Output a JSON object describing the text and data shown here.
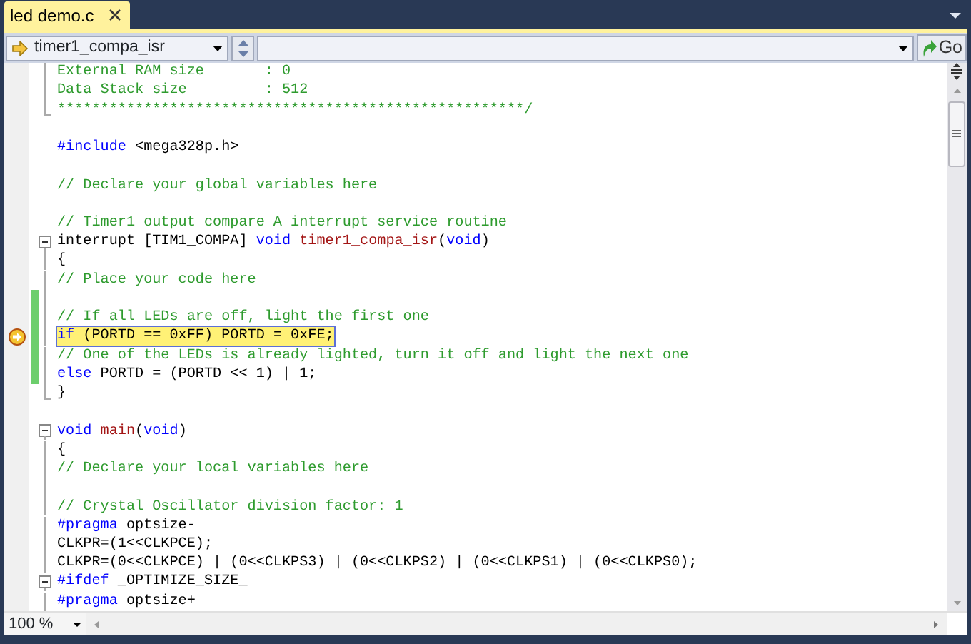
{
  "tab": {
    "title": "led demo.c",
    "selected": true
  },
  "toolbar": {
    "member_dropdown": {
      "value": "timer1_compa_isr"
    },
    "go_button": {
      "label": "Go"
    }
  },
  "code_lines": [
    {
      "segments": [
        {
          "kind": "comment",
          "text": "External RAM size       : 0"
        }
      ],
      "collapsible": false,
      "in_region": true,
      "region_end": false,
      "changed": false,
      "current": false
    },
    {
      "segments": [
        {
          "kind": "comment",
          "text": "Data Stack size         : 512"
        }
      ],
      "collapsible": false,
      "in_region": true,
      "region_end": false,
      "changed": false,
      "current": false
    },
    {
      "segments": [
        {
          "kind": "comment",
          "text": "******************************************************/"
        }
      ],
      "collapsible": false,
      "in_region": true,
      "region_end": true,
      "changed": false,
      "current": false
    },
    {
      "collapsible": false,
      "in_region": false,
      "region_end": false,
      "changed": false,
      "current": false
    },
    {
      "segments": [
        {
          "kind": "keyword",
          "text": "#include"
        },
        {
          "kind": "plain",
          "text": " <mega328p.h>"
        }
      ],
      "collapsible": false,
      "in_region": false,
      "region_end": false,
      "changed": false,
      "current": false
    },
    {
      "collapsible": false,
      "in_region": false,
      "region_end": false,
      "changed": false,
      "current": false
    },
    {
      "segments": [
        {
          "kind": "comment",
          "text": "// Declare your global variables here"
        }
      ],
      "collapsible": false,
      "in_region": false,
      "region_end": false,
      "changed": false,
      "current": false
    },
    {
      "collapsible": false,
      "in_region": false,
      "region_end": false,
      "changed": false,
      "current": false
    },
    {
      "segments": [
        {
          "kind": "comment",
          "text": "// Timer1 output compare A interrupt service routine"
        }
      ],
      "collapsible": false,
      "in_region": false,
      "region_end": false,
      "changed": false,
      "current": false
    },
    {
      "segments": [
        {
          "kind": "plain",
          "text": "interrupt [TIM1_COMPA] "
        },
        {
          "kind": "keyword",
          "text": "void "
        },
        {
          "kind": "function",
          "text": "timer1_compa_isr"
        },
        {
          "kind": "plain",
          "text": "("
        },
        {
          "kind": "keyword",
          "text": "void"
        },
        {
          "kind": "plain",
          "text": ")"
        }
      ],
      "collapsible": true,
      "in_region": true,
      "region_end": false,
      "changed": false,
      "current": false
    },
    {
      "segments": [
        {
          "kind": "plain",
          "text": "{"
        }
      ],
      "collapsible": false,
      "in_region": true,
      "region_end": false,
      "changed": false,
      "current": false
    },
    {
      "segments": [
        {
          "kind": "comment",
          "text": "// Place your code here"
        }
      ],
      "collapsible": false,
      "in_region": true,
      "region_end": false,
      "changed": false,
      "current": false
    },
    {
      "collapsible": false,
      "in_region": true,
      "region_end": false,
      "changed": true,
      "current": false
    },
    {
      "segments": [
        {
          "kind": "comment",
          "text": "// If all LEDs are off, light the first one"
        }
      ],
      "collapsible": false,
      "in_region": true,
      "region_end": false,
      "changed": true,
      "current": false
    },
    {
      "segments": [
        {
          "kind": "keyword",
          "text": "if"
        },
        {
          "kind": "plain",
          "text": " (PORTD == 0xFF) PORTD = 0xFE;"
        }
      ],
      "collapsible": false,
      "in_region": true,
      "region_end": false,
      "changed": true,
      "current": true
    },
    {
      "segments": [
        {
          "kind": "comment",
          "text": "// One of the LEDs is already lighted, turn it off and light the next one"
        }
      ],
      "collapsible": false,
      "in_region": true,
      "region_end": false,
      "changed": true,
      "current": false
    },
    {
      "segments": [
        {
          "kind": "keyword",
          "text": "else"
        },
        {
          "kind": "plain",
          "text": " PORTD = (PORTD << 1) | 1;"
        }
      ],
      "collapsible": false,
      "in_region": true,
      "region_end": false,
      "changed": true,
      "current": false
    },
    {
      "segments": [
        {
          "kind": "plain",
          "text": "}"
        }
      ],
      "collapsible": false,
      "in_region": true,
      "region_end": true,
      "changed": false,
      "current": false
    },
    {
      "collapsible": false,
      "in_region": false,
      "region_end": false,
      "changed": false,
      "current": false
    },
    {
      "segments": [
        {
          "kind": "keyword",
          "text": "void "
        },
        {
          "kind": "function",
          "text": "main"
        },
        {
          "kind": "plain",
          "text": "("
        },
        {
          "kind": "keyword",
          "text": "void"
        },
        {
          "kind": "plain",
          "text": ")"
        }
      ],
      "collapsible": true,
      "in_region": true,
      "region_end": false,
      "changed": false,
      "current": false
    },
    {
      "segments": [
        {
          "kind": "plain",
          "text": "{"
        }
      ],
      "collapsible": false,
      "in_region": true,
      "region_end": false,
      "changed": false,
      "current": false
    },
    {
      "segments": [
        {
          "kind": "comment",
          "text": "// Declare your local variables here"
        }
      ],
      "collapsible": false,
      "in_region": true,
      "region_end": false,
      "changed": false,
      "current": false
    },
    {
      "collapsible": false,
      "in_region": true,
      "region_end": false,
      "changed": false,
      "current": false
    },
    {
      "segments": [
        {
          "kind": "comment",
          "text": "// Crystal Oscillator division factor: 1"
        }
      ],
      "collapsible": false,
      "in_region": true,
      "region_end": false,
      "changed": false,
      "current": false
    },
    {
      "segments": [
        {
          "kind": "keyword",
          "text": "#pragma"
        },
        {
          "kind": "plain",
          "text": " optsize-"
        }
      ],
      "collapsible": false,
      "in_region": true,
      "region_end": false,
      "changed": false,
      "current": false
    },
    {
      "segments": [
        {
          "kind": "plain",
          "text": "CLKPR=(1<<CLKPCE);"
        }
      ],
      "collapsible": false,
      "in_region": true,
      "region_end": false,
      "changed": false,
      "current": false
    },
    {
      "segments": [
        {
          "kind": "plain",
          "text": "CLKPR=(0<<CLKPCE) | (0<<CLKPS3) | (0<<CLKPS2) | (0<<CLKPS1) | (0<<CLKPS0);"
        }
      ],
      "collapsible": false,
      "in_region": true,
      "region_end": false,
      "changed": false,
      "current": false
    },
    {
      "segments": [
        {
          "kind": "keyword",
          "text": "#ifdef"
        },
        {
          "kind": "plain",
          "text": " _OPTIMIZE_SIZE_"
        }
      ],
      "collapsible": true,
      "in_region": true,
      "region_end": false,
      "changed": false,
      "current": false
    },
    {
      "segments": [
        {
          "kind": "keyword",
          "text": "#pragma"
        },
        {
          "kind": "plain",
          "text": " optsize+"
        }
      ],
      "collapsible": false,
      "in_region": true,
      "region_end": false,
      "changed": false,
      "current": false
    }
  ],
  "status_bar": {
    "zoom": "100 %"
  }
}
